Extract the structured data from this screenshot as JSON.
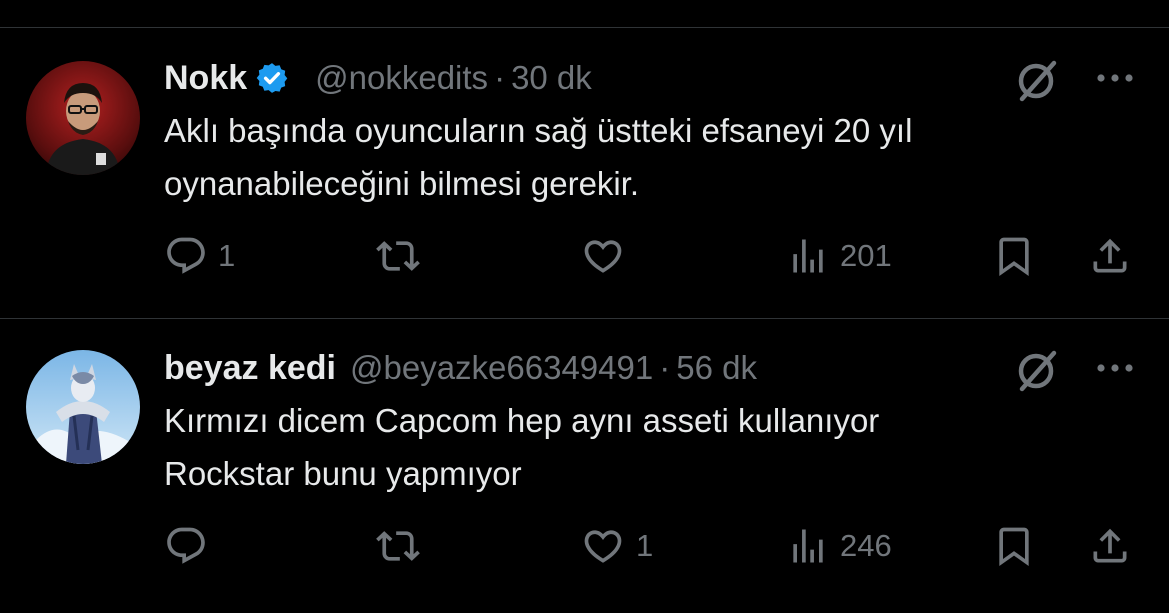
{
  "colors": {
    "background": "#000000",
    "text_primary": "#e7e9ea",
    "text_secondary": "#71767b",
    "verified_blue": "#1d9bf0",
    "divider": "#2f3336"
  },
  "tweets": [
    {
      "display_name": "Nokk",
      "verified": true,
      "handle": "@nokkedits",
      "separator": "·",
      "time": "30 dk",
      "lines": [
        "Aklı başında oyuncuların sağ üstteki efsaneyi 20 yıl",
        "oynanabileceğini bilmesi gerekir."
      ],
      "replies": "1",
      "reposts": "",
      "likes": "",
      "views": "201",
      "avatar_icon": "person-avatar"
    },
    {
      "display_name": "beyaz kedi",
      "verified": false,
      "handle": "@beyazke66349491",
      "separator": "·",
      "time": "56 dk",
      "lines": [
        "Kırmızı dicem Capcom hep aynı asseti kullanıyor",
        "Rockstar bunu yapmıyor"
      ],
      "replies": "",
      "reposts": "",
      "likes": "1",
      "views": "246",
      "avatar_icon": "anime-character-avatar"
    }
  ],
  "icons": {
    "reply": "reply-icon",
    "repost": "repost-icon",
    "like": "heart-icon",
    "views": "views-icon",
    "bookmark": "bookmark-icon",
    "share": "share-icon",
    "grok": "grok-icon",
    "more": "more-icon",
    "verified": "verified-badge-icon"
  }
}
